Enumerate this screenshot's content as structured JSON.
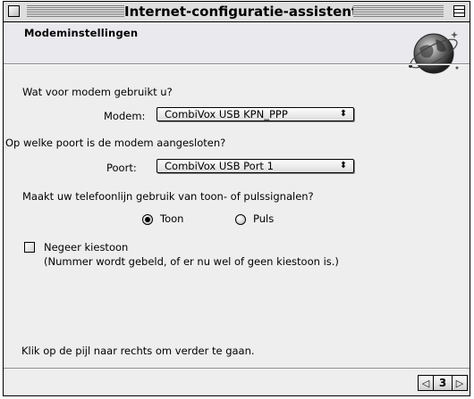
{
  "window": {
    "title": "Internet-configuratie-assistent"
  },
  "header": {
    "section_title": "Modeminstellingen"
  },
  "modem": {
    "question": "Wat voor modem gebruikt u?",
    "label": "Modem:",
    "selected": "CombiVox USB KPN_PPP"
  },
  "port": {
    "question": "Op welke poort is de modem aangesloten?",
    "label": "Poort:",
    "selected": "CombiVox USB Port 1"
  },
  "dialing": {
    "question": "Maakt uw telefoonlijn gebruik van toon- of pulssignalen?",
    "options": [
      {
        "label": "Toon",
        "selected": true
      },
      {
        "label": "Puls",
        "selected": false
      }
    ]
  },
  "ignore_dialtone": {
    "label": "Negeer kiestoon",
    "note": "(Nummer wordt gebeld, of er nu wel of geen kiestoon is.)",
    "checked": false
  },
  "instruction": "Klik op de pijl naar rechts om verder te gaan.",
  "navigation": {
    "page": "3"
  },
  "icons": {
    "close": "close-box-icon",
    "zoom": "zoom-box-icon",
    "globe": "globe-icon",
    "popup_arrows": "updown-arrow-icon",
    "back": "left-arrow-icon",
    "forward": "right-arrow-icon"
  }
}
